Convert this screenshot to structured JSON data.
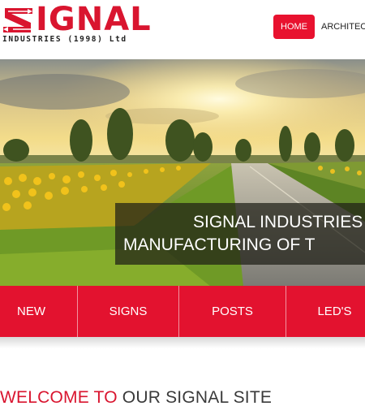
{
  "brand": {
    "logo_word": "IGNAL",
    "logo_subtitle": "INDUSTRIES (1998) Ltd",
    "accent_color": "#e3122f"
  },
  "nav": {
    "items": [
      {
        "label": "HOME",
        "active": true
      },
      {
        "label": "ARCHITECTU"
      }
    ]
  },
  "hero": {
    "caption_line1": "SIGNAL INDUSTRIES H",
    "caption_line2": "MANUFACTURING OF T"
  },
  "categories": [
    {
      "label": "NEW"
    },
    {
      "label": "SIGNS"
    },
    {
      "label": "POSTS"
    },
    {
      "label": "LED'S"
    }
  ],
  "welcome": {
    "red_part": "WELCOME TO",
    "dark_part": "OUR SIGNAL SITE"
  }
}
